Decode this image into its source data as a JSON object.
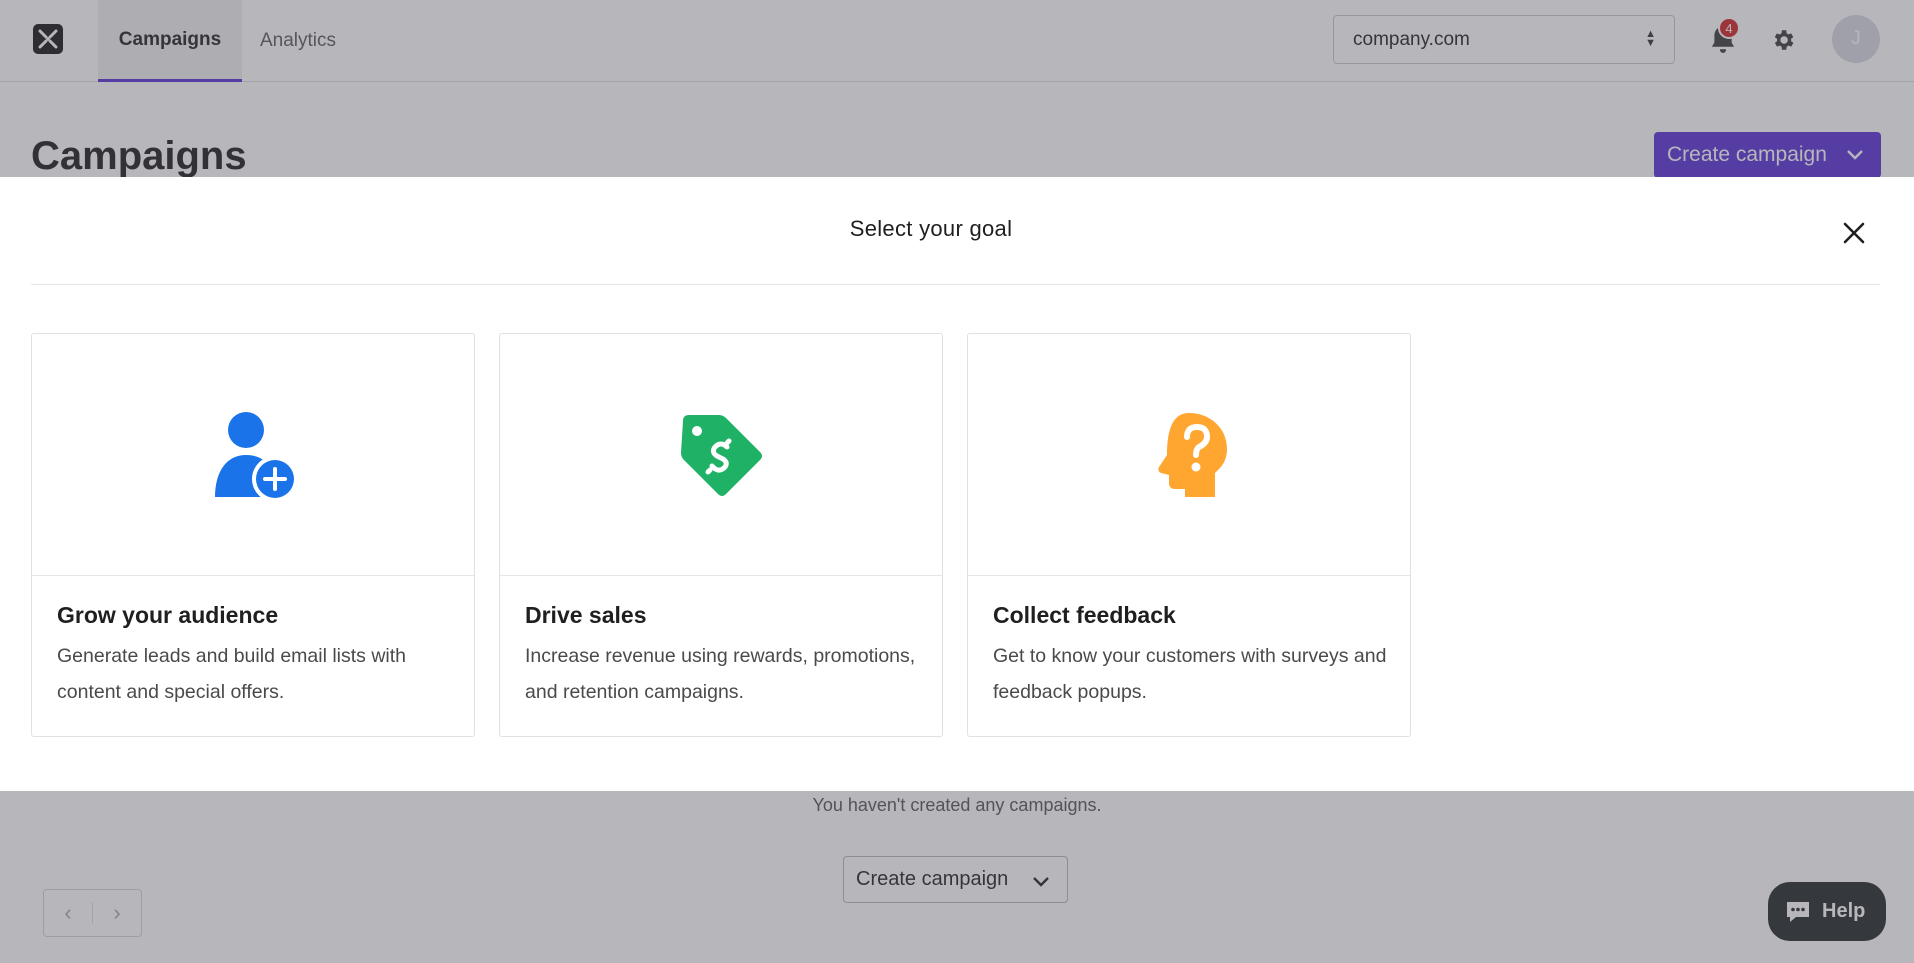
{
  "nav": {
    "tabs": [
      {
        "label": "Campaigns"
      },
      {
        "label": "Analytics"
      }
    ],
    "domain_select": {
      "value": "company.com"
    },
    "notifications": {
      "count": "4"
    },
    "avatar_initial": "J"
  },
  "page": {
    "title": "Campaigns",
    "create_button_label": "Create campaign",
    "empty_message": "You haven't created any campaigns.",
    "create_button_bottom_label": "Create campaign",
    "help_label": "Help"
  },
  "modal": {
    "title": "Select your goal",
    "goals": [
      {
        "title": "Grow your audience",
        "description": "Generate leads and build email lists with content and special offers.",
        "icon": "user-plus-icon",
        "color": "#1a73e8"
      },
      {
        "title": "Drive sales",
        "description": "Increase revenue using rewards, promotions, and retention campaigns.",
        "icon": "price-tag-icon",
        "color": "#1fb266"
      },
      {
        "title": "Collect feedback",
        "description": "Get to know your customers with surveys and feedback popups.",
        "icon": "head-question-icon",
        "color": "#ffa631"
      }
    ]
  },
  "colors": {
    "accent": "#5b2fd6",
    "notification_badge": "#d32222"
  }
}
